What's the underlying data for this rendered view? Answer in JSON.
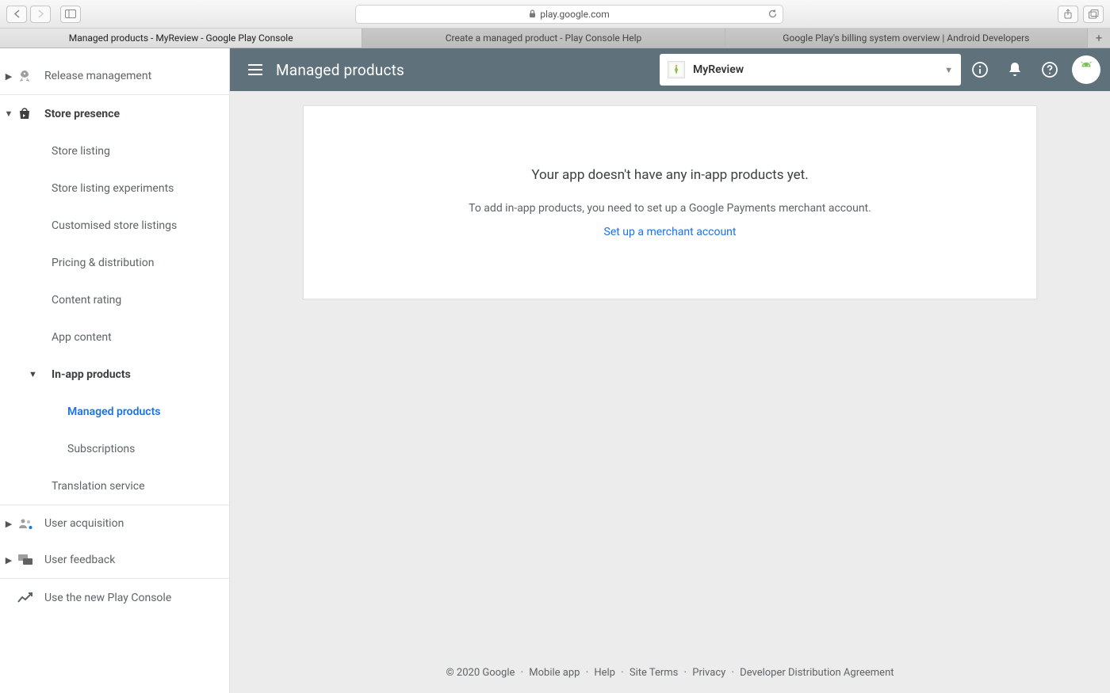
{
  "browser": {
    "url_host": "play.google.com",
    "tabs": [
      {
        "label": "Managed products - MyReview - Google Play Console",
        "active": true
      },
      {
        "label": "Create a managed product - Play Console Help",
        "active": false
      },
      {
        "label": "Google Play's billing system overview  |  Android Developers",
        "active": false
      }
    ]
  },
  "topbar": {
    "title": "Managed products",
    "app_name": "MyReview"
  },
  "sidebar": {
    "release_management": "Release management",
    "store_presence": "Store presence",
    "items": [
      "Store listing",
      "Store listing experiments",
      "Customised store listings",
      "Pricing & distribution",
      "Content rating",
      "App content"
    ],
    "inapp": "In-app products",
    "inapp_children": [
      "Managed products",
      "Subscriptions"
    ],
    "translation_service": "Translation service",
    "user_acquisition": "User acquisition",
    "user_feedback": "User feedback",
    "use_new_console": "Use the new Play Console"
  },
  "card": {
    "heading": "Your app doesn't have any in-app products yet.",
    "body": "To add in-app products, you need to set up a Google Payments merchant account.",
    "link": "Set up a merchant account"
  },
  "footer": {
    "copyright": "© 2020 Google",
    "links": [
      "Mobile app",
      "Help",
      "Site Terms",
      "Privacy",
      "Developer Distribution Agreement"
    ]
  }
}
